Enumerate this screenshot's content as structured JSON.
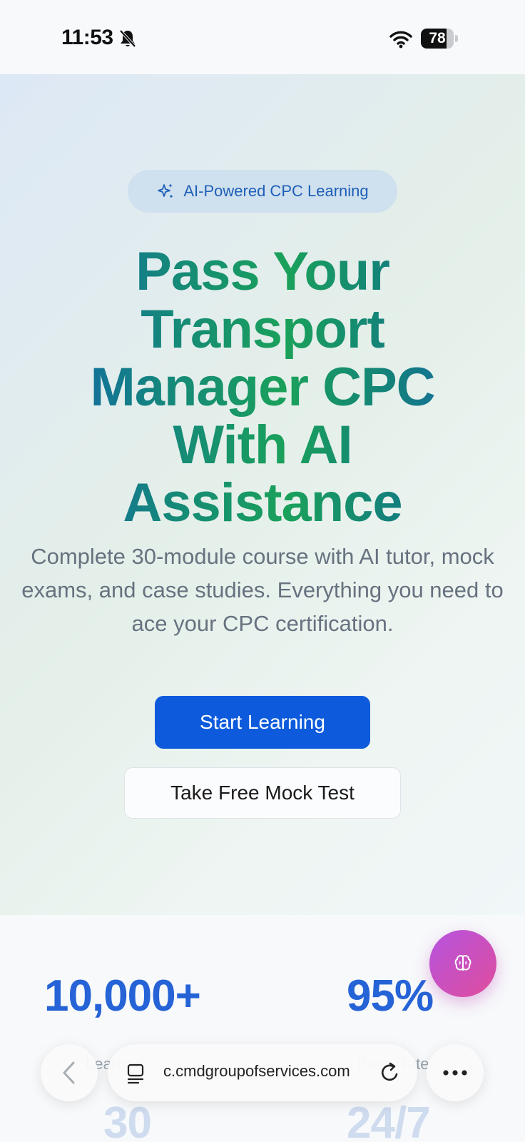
{
  "status_bar": {
    "time": "11:53",
    "battery": "78",
    "battery_level": 0.78
  },
  "hero": {
    "badge_label": "AI-Powered CPC Learning",
    "headline_lines": [
      "Pass Your",
      "Transport",
      "Manager CPC",
      "With AI",
      "Assistance"
    ],
    "subtext": "Complete 30-module course with AI tutor, mock exams, and case studies. Everything you need to ace your CPC certification.",
    "primary_button": "Start Learning",
    "secondary_button": "Take Free Mock Test"
  },
  "stats": [
    {
      "value": "10,000+",
      "label": "Learners"
    },
    {
      "value": "95%",
      "label": "Pass Rate"
    },
    {
      "value": "30",
      "label": ""
    },
    {
      "value": "24/7",
      "label": ""
    }
  ],
  "browser": {
    "url": "c.cmdgroupofservices.com"
  },
  "icons": [
    "bell-slash-icon",
    "wifi-icon",
    "battery-icon",
    "sparkle-icon",
    "brain-icon",
    "back-chevron-icon",
    "tabs-icon",
    "reload-icon",
    "more-icon"
  ],
  "colors": {
    "primary": "#0d5bdc",
    "stat_blue": "#2563d6",
    "fab_start": "#b553e0",
    "fab_end": "#e04d9c"
  }
}
